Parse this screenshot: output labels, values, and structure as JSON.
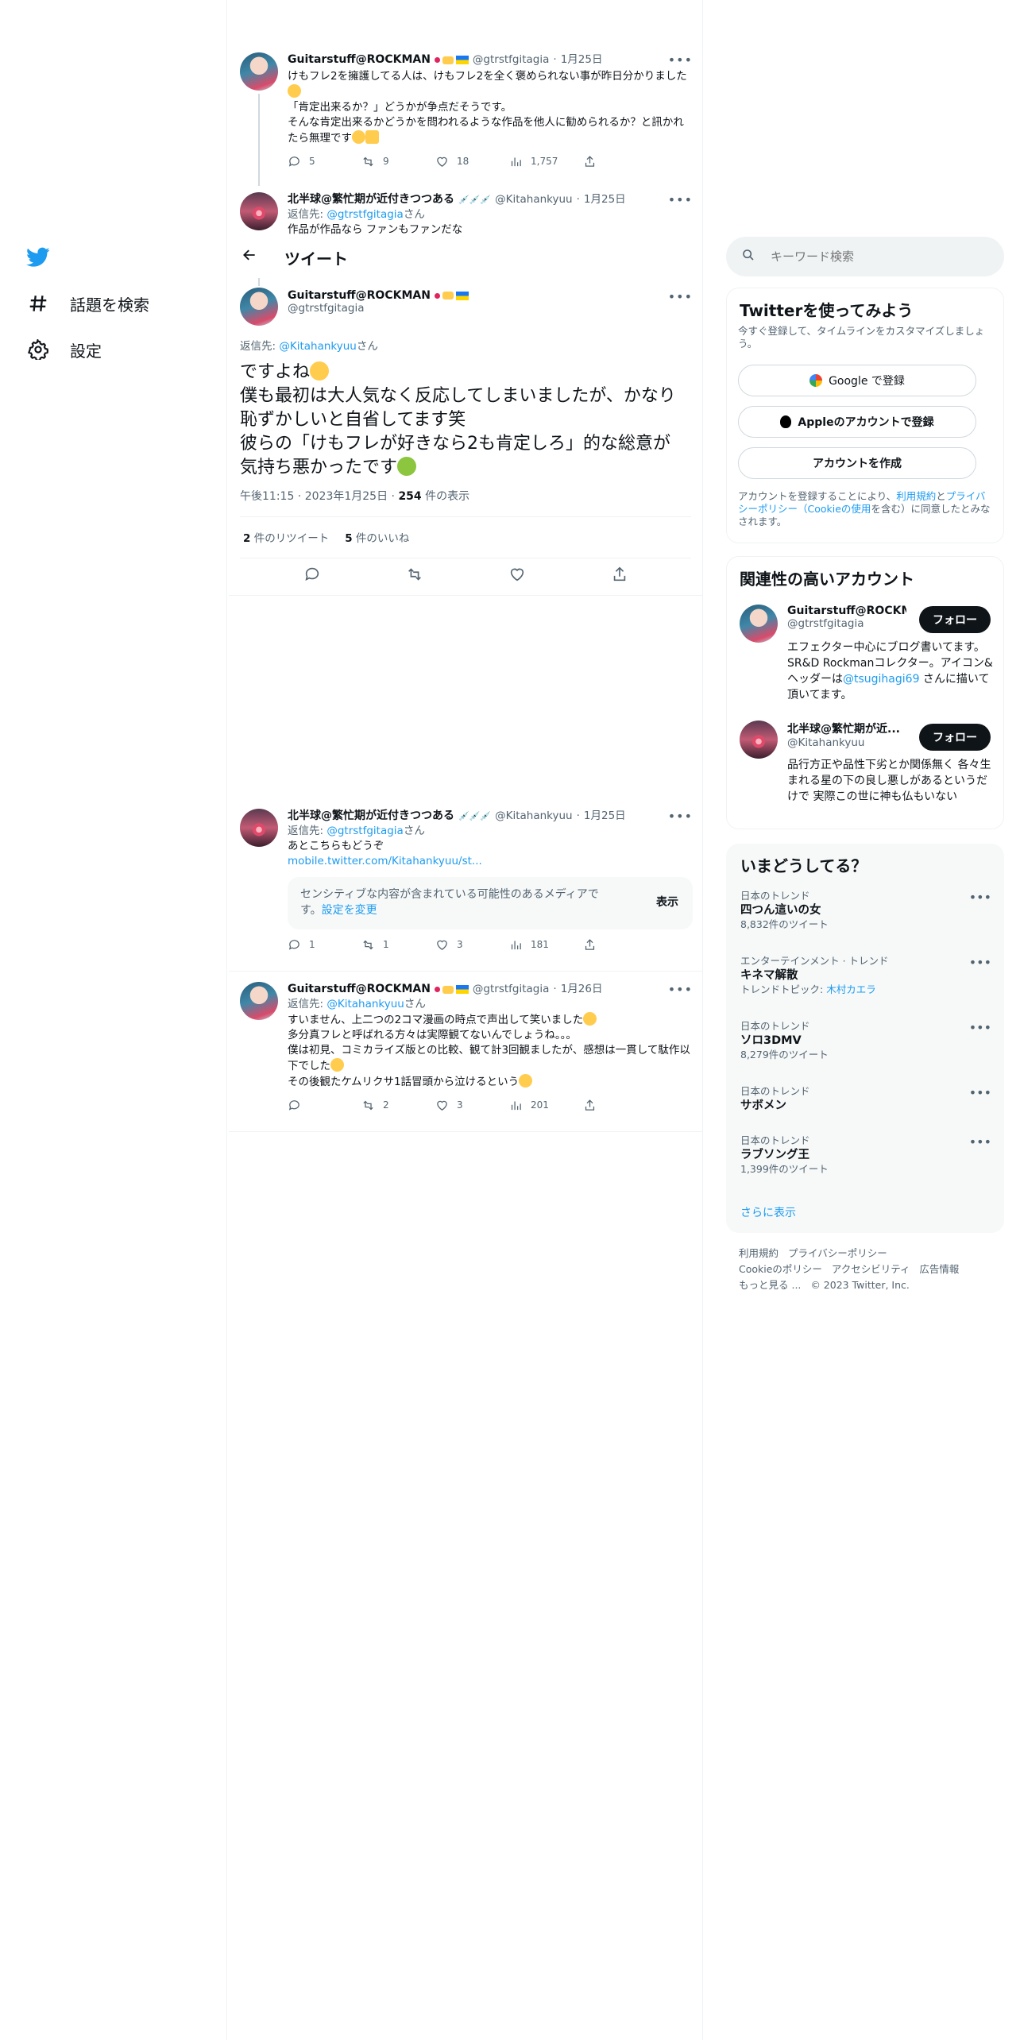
{
  "nav": {
    "explore_label": "話題を検索",
    "settings_label": "設定"
  },
  "header": {
    "title": "ツイート"
  },
  "tweets": {
    "t1": {
      "name": "Guitarstuff@ROCKMAN",
      "handle": "@gtrstfgitagia",
      "date": "1月25日",
      "text": "けもフレ2を擁護してる人は、けもフレ2を全く褒められない事が昨日分かりました",
      "text2": "「肯定出来るか？」どうかが争点だそうです。\nそんな肯定出来るかどうかを問われるような作品を他人に勧められるか？と訊かれたら無理です",
      "replies": "5",
      "retweets": "9",
      "likes": "18",
      "views": "1,757"
    },
    "t2": {
      "name": "北半球@繁忙期が近付きつつある",
      "handle": "@Kitahankyuu",
      "date": "1月25日",
      "reply_prefix": "返信先: ",
      "reply_to": "@gtrstfgitagia",
      "reply_suffix": "さん",
      "text": "作品が作品なら ファンもファンだな"
    },
    "main": {
      "name": "Guitarstuff@ROCKMAN",
      "handle": "@gtrstfgitagia",
      "reply_prefix": "返信先: ",
      "reply_to": "@Kitahankyuu",
      "reply_suffix": "さん",
      "text_line1": "ですよね",
      "text_rest": "僕も最初は大人気なく反応してしまいましたが、かなり恥ずかしいと自省してます笑\n彼らの「けもフレが好きなら2も肯定しろ」的な総意が気持ち悪かったです",
      "time": "午後11:15",
      "date": "2023年1月25日",
      "views_count": "254",
      "views_label": "件の表示",
      "retweets_count": "2",
      "retweets_label": "件のリツイート",
      "likes_count": "5",
      "likes_label": "件のいいね"
    },
    "t4": {
      "name": "北半球@繁忙期が近付きつつある",
      "handle": "@Kitahankyuu",
      "date": "1月25日",
      "reply_prefix": "返信先: ",
      "reply_to": "@gtrstfgitagia",
      "reply_suffix": "さん",
      "text": "あとこちらもどうぞ",
      "link": "mobile.twitter.com/Kitahankyuu/st...",
      "sensitive_text": "センシティブな内容が含まれている可能性のあるメディアです。",
      "sensitive_link": "設定を変更",
      "show_label": "表示",
      "replies": "1",
      "retweets": "1",
      "likes": "3",
      "views": "181"
    },
    "t5": {
      "name": "Guitarstuff@ROCKMAN",
      "handle": "@gtrstfgitagia",
      "date": "1月26日",
      "reply_prefix": "返信先: ",
      "reply_to": "@Kitahankyuu",
      "reply_suffix": "さん",
      "text1": "すいません、上二つの2コマ漫画の時点で声出して笑いました",
      "text2": "多分真フレと呼ばれる方々は実際観てないんでしょうね。。。\n僕は初見、コミカライズ版との比較、観て計3回観ましたが、感想は一貫して駄作以下でした",
      "text3": "その後観たケムリクサ1話冒頭から泣けるという",
      "replies": "",
      "retweets": "2",
      "likes": "3",
      "views": "201"
    }
  },
  "search": {
    "placeholder": "キーワード検索"
  },
  "signup": {
    "title": "Twitterを使ってみよう",
    "subtitle": "今すぐ登録して、タイムラインをカスタマイズしましょう。",
    "google_label": "Google で登録",
    "apple_label": "Appleのアカウントで登録",
    "create_label": "アカウントを作成",
    "terms_prefix": "アカウントを登録することにより、",
    "terms_link1": "利用規約",
    "terms_and": "と",
    "terms_link2": "プライバシーポリシー（Cookieの使用",
    "terms_mid": "を含む）に同意したとみなされます。"
  },
  "related": {
    "title": "関連性の高いアカウント",
    "follow_label": "フォロー",
    "accounts": [
      {
        "name": "Guitarstuff@ROCKM...",
        "handle": "@gtrstfgitagia",
        "bio_prefix": "エフェクター中心にブログ書いてます。 SR&D Rockmanコレクター。アイコン&ヘッダーは",
        "bio_link": "@tsugihagi69",
        "bio_suffix": " さんに描いて頂いてます。"
      },
      {
        "name": "北半球@繁忙期が近...",
        "handle": "@Kitahankyuu",
        "bio": "品行方正や品性下劣とか関係無く 各々生まれる星の下の良し悪しがあるというだけで 実際この世に神も仏もいない"
      }
    ]
  },
  "trends": {
    "title": "いまどうしてる？",
    "items": [
      {
        "category": "日本のトレンド",
        "name": "四つん這いの女",
        "count": "8,832件のツイート"
      },
      {
        "category": "エンターテインメント · トレンド",
        "name": "キネマ解散",
        "count_prefix": "トレンドトピック: ",
        "count_link": "木村カエラ"
      },
      {
        "category": "日本のトレンド",
        "name": "ソロ3DMV",
        "count": "8,279件のツイート"
      },
      {
        "category": "日本のトレンド",
        "name": "サボメン"
      },
      {
        "category": "日本のトレンド",
        "name": "ラブソング王",
        "count": "1,399件のツイート"
      }
    ],
    "show_more": "さらに表示"
  },
  "footer": {
    "terms": "利用規約",
    "privacy": "プライバシーポリシー",
    "cookie": "Cookieのポリシー",
    "accessibility": "アクセシビリティ",
    "ads": "広告情報",
    "more": "もっと見る ...",
    "copyright": "© 2023 Twitter, Inc."
  },
  "colors": {
    "accent": "#1d9bf0",
    "text": "#0f1419",
    "muted": "#536471",
    "border": "#eff3f4",
    "panel": "#f7f9f9"
  }
}
